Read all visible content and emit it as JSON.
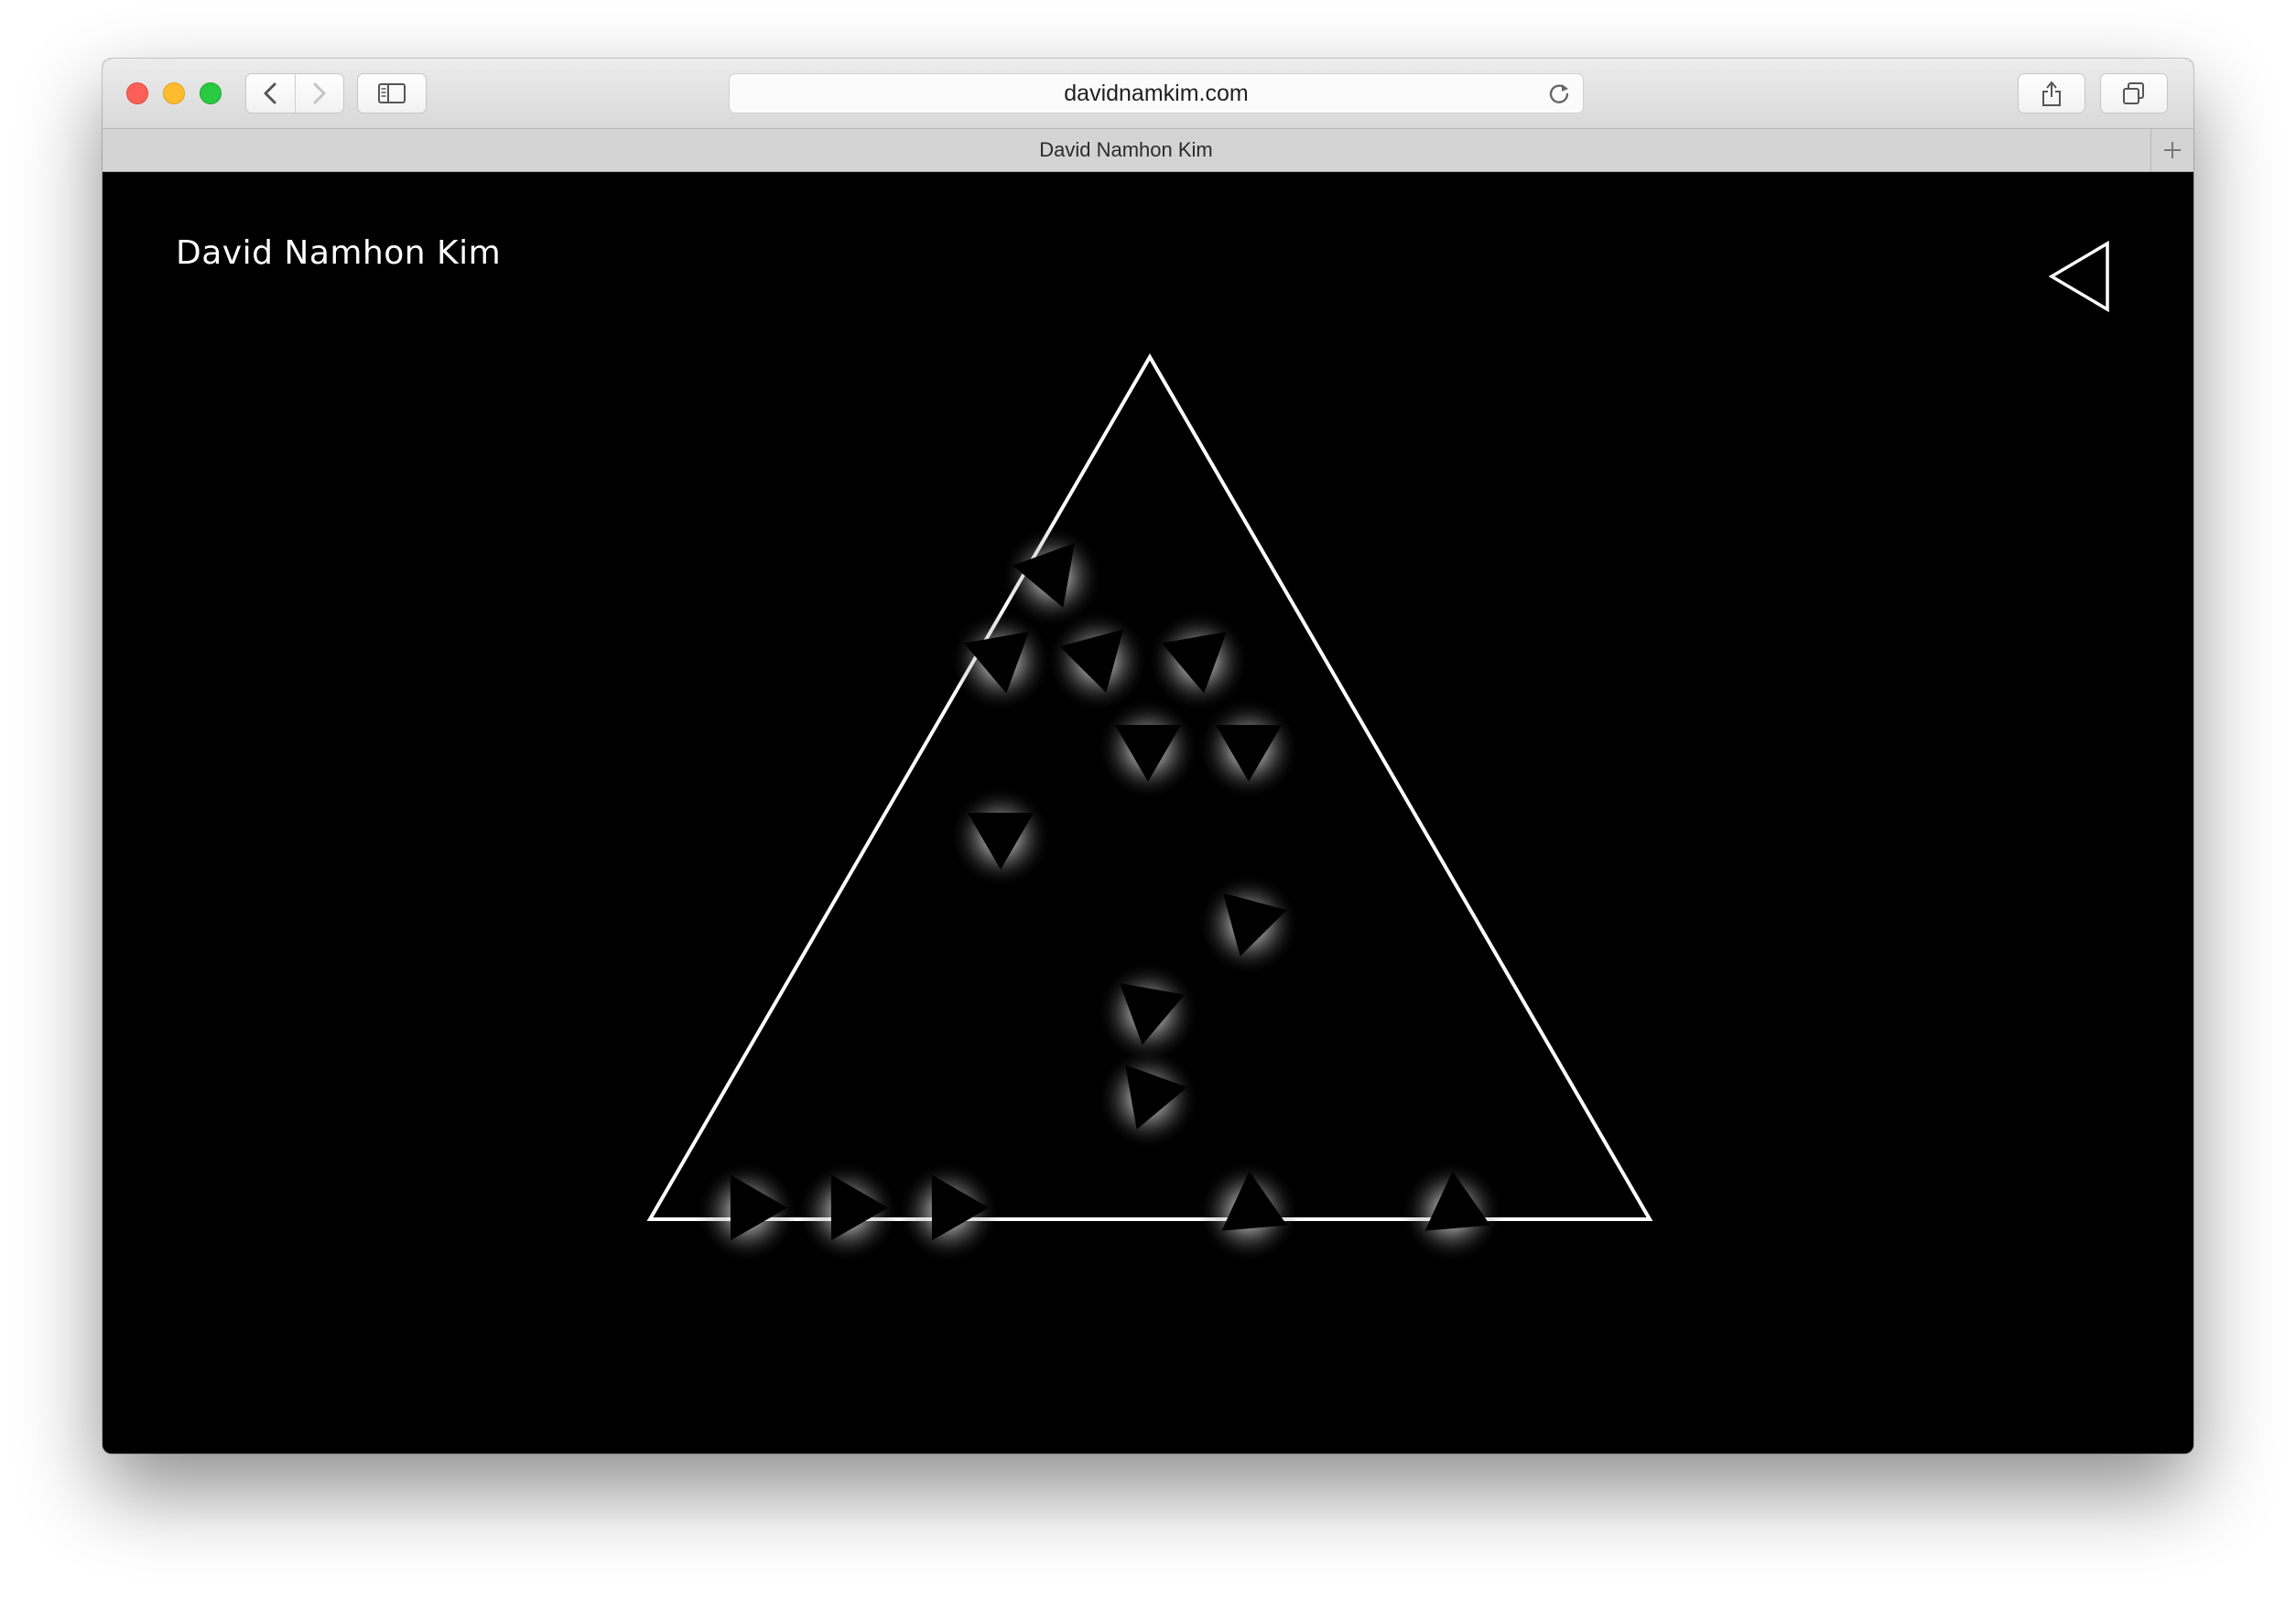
{
  "browser": {
    "url": "davidnamkim.com",
    "tab_title": "David Namhon Kim",
    "icons": {
      "back": "chevron-left-icon",
      "forward": "chevron-right-icon",
      "sidebar": "sidebar-icon",
      "reload": "reload-icon",
      "share": "share-icon",
      "tabs": "tabs-overview-icon",
      "new_tab": "plus-icon"
    },
    "traffic_colors": {
      "close": "#fc5f57",
      "minimize": "#fdbc2e",
      "maximize": "#29c941"
    }
  },
  "page": {
    "site_title": "David Namhon Kim",
    "menu_icon": "triangle-left-outline-icon",
    "background": "#000000",
    "foreground": "#ffffff",
    "shape_count": 17
  }
}
